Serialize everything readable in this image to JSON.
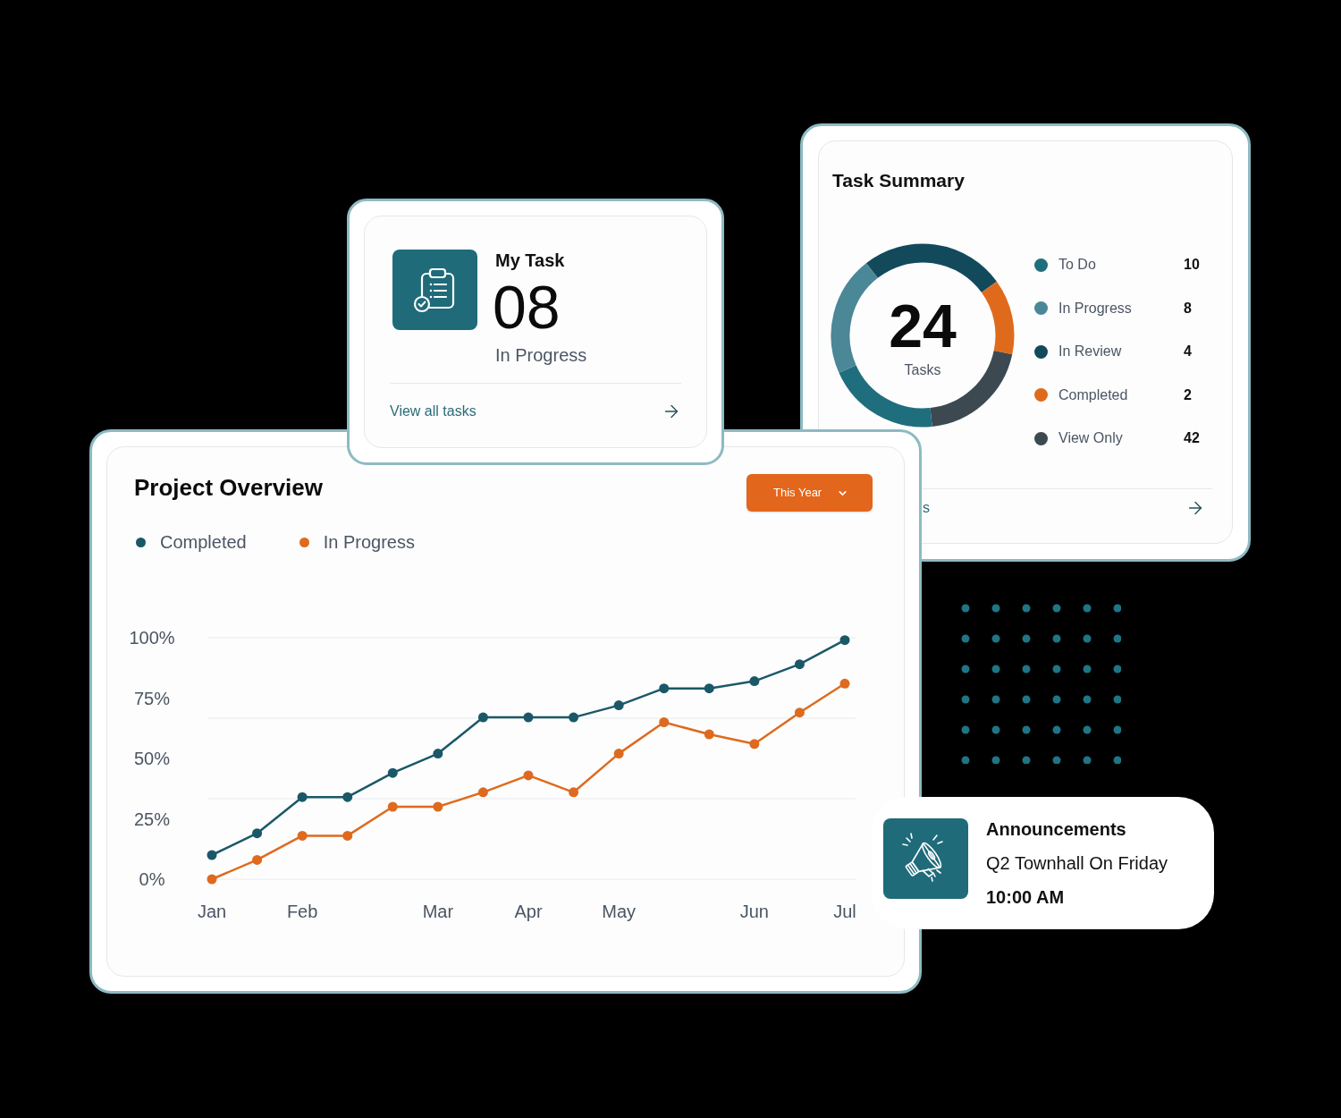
{
  "task_summary": {
    "title": "Task Summary",
    "total": "24",
    "total_label": "Tasks",
    "legend": [
      {
        "label": "To Do",
        "value": "10",
        "color": "#1f6e7e"
      },
      {
        "label": "In Progress",
        "value": "8",
        "color": "#4a8797"
      },
      {
        "label": "In Review",
        "value": "4",
        "color": "#124a5c"
      },
      {
        "label": "Completed",
        "value": "2",
        "color": "#e06a1c"
      },
      {
        "label": "View Only",
        "value": "42",
        "color": "#3c4951"
      }
    ],
    "link": "s"
  },
  "my_task": {
    "title": "My Task",
    "count": "08",
    "status": "In Progress",
    "link": "View all tasks"
  },
  "project_overview": {
    "title": "Project Overview",
    "period": "This Year",
    "chart_data": {
      "type": "line",
      "categories": [
        "Jan",
        null,
        "Feb",
        null,
        null,
        "Mar",
        null,
        "Apr",
        null,
        "May",
        null,
        null,
        "Jun",
        null,
        "Jul"
      ],
      "series": [
        {
          "name": "Completed",
          "color": "#1a5868",
          "marker": "circle",
          "values": [
            10,
            19,
            34,
            34,
            44,
            52,
            67,
            67,
            67,
            72,
            79,
            79,
            82,
            89,
            99
          ]
        },
        {
          "name": "In Progress",
          "color": "#de6a1f",
          "marker": "circle",
          "values": [
            0,
            8,
            18,
            18,
            30,
            30,
            36,
            43,
            36,
            52,
            65,
            60,
            56,
            69,
            81
          ]
        }
      ],
      "ylim": [
        0,
        100
      ],
      "yticks": [
        {
          "value": 0,
          "label": "0%"
        },
        {
          "value": 25,
          "label": "25%"
        },
        {
          "value": 50,
          "label": "50%"
        },
        {
          "value": 75,
          "label": "75%"
        },
        {
          "value": 100,
          "label": "100%"
        }
      ],
      "ref_lines": [
        {
          "axis": "y",
          "value": 33.33
        },
        {
          "axis": "y",
          "value": 66.67
        }
      ]
    }
  },
  "announcement": {
    "title": "Announcements",
    "text": "Q2 Townhall On Friday",
    "time": "10:00 AM"
  }
}
